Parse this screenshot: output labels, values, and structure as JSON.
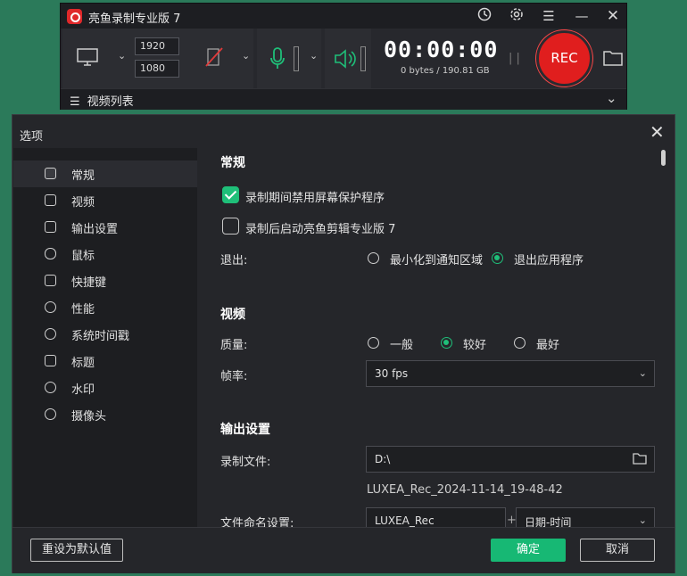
{
  "recorder": {
    "title": "亮鱼录制专业版 7",
    "width": "1920",
    "height": "1080",
    "time": "00:00:00",
    "storage": "0 bytes / 190.81 GB",
    "rec_label": "REC",
    "video_list": "视频列表",
    "icons": [
      "clock-icon",
      "gear-icon",
      "menu-icon",
      "minimize-icon",
      "close-icon",
      "monitor-icon",
      "no-camera-icon",
      "microphone-icon",
      "speaker-icon",
      "folder-icon"
    ]
  },
  "dialog": {
    "title": "选项",
    "sidebar": [
      {
        "label": "常规",
        "icon": "general-icon"
      },
      {
        "label": "视频",
        "icon": "video-icon"
      },
      {
        "label": "输出设置",
        "icon": "output-icon"
      },
      {
        "label": "鼠标",
        "icon": "mouse-icon"
      },
      {
        "label": "快捷键",
        "icon": "keyboard-icon"
      },
      {
        "label": "性能",
        "icon": "performance-icon"
      },
      {
        "label": "系统时间戳",
        "icon": "clock-icon"
      },
      {
        "label": "标题",
        "icon": "title-icon"
      },
      {
        "label": "水印",
        "icon": "watermark-icon"
      },
      {
        "label": "摄像头",
        "icon": "webcam-icon"
      }
    ],
    "general": {
      "title": "常规",
      "opt1": "录制期间禁用屏幕保护程序",
      "opt1_checked": true,
      "opt2": "录制后启动亮鱼剪辑专业版 7",
      "opt2_checked": false,
      "exit_label": "退出:",
      "exit_opt1": "最小化到通知区域",
      "exit_opt2": "退出应用程序",
      "exit_selected": "退出应用程序"
    },
    "video": {
      "title": "视频",
      "quality_label": "质量:",
      "q1": "一般",
      "q2": "较好",
      "q3": "最好",
      "quality_selected": "较好",
      "fps_label": "帧率:",
      "fps_value": "30 fps"
    },
    "output": {
      "title": "输出设置",
      "file_label": "录制文件:",
      "path": "D:\\",
      "filename": "LUXEA_Rec_2024-11-14_19-48-42",
      "naming_label": "文件命名设置:",
      "naming_prefix": "LUXEA_Rec",
      "naming_sep": "+",
      "naming_format": "日期-时间"
    },
    "reset_label": "重设为默认值",
    "ok_label": "确定",
    "cancel_label": "取消"
  },
  "colors": {
    "accent": "#1fbf79",
    "rec": "#e01e1e",
    "desktop": "#2b7a5a"
  }
}
